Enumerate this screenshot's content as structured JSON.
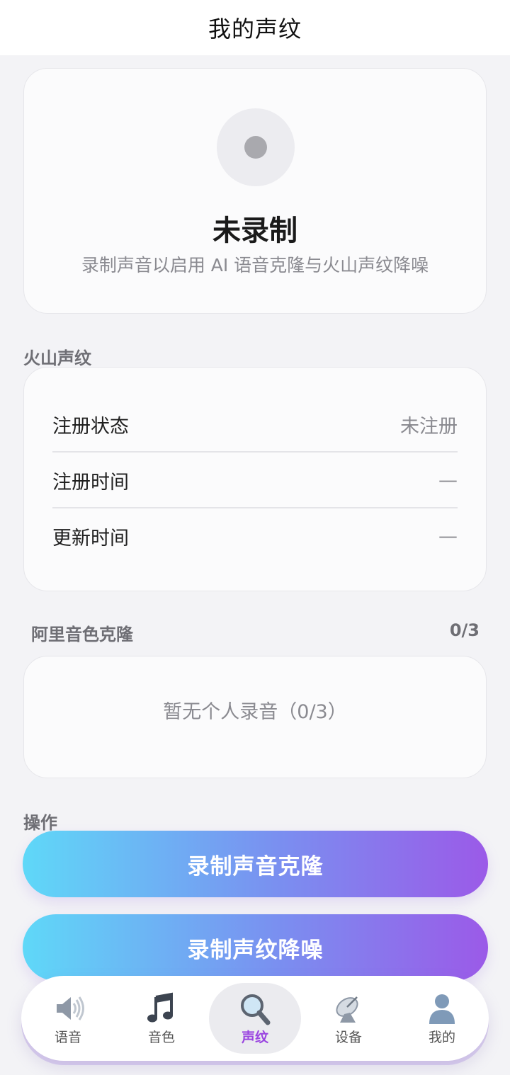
{
  "header": {
    "title": "我的声纹"
  },
  "status_card": {
    "title": "未录制",
    "subtitle": "录制声音以启用 AI 语音克隆与火山声纹降噪"
  },
  "volc_section": {
    "label": "火山声纹",
    "rows": [
      {
        "label": "注册状态",
        "value": "未注册"
      },
      {
        "label": "注册时间",
        "value": "—"
      },
      {
        "label": "更新时间",
        "value": "—"
      }
    ]
  },
  "ali_section": {
    "label": "阿里音色克隆",
    "count": "0/3",
    "empty_text": "暂无个人录音（0/3）"
  },
  "actions": {
    "label": "操作",
    "record_clone": "录制声音克隆",
    "record_denoise": "录制声纹降噪"
  },
  "tabbar": {
    "tabs": [
      {
        "label": "语音",
        "icon": "speaker-icon"
      },
      {
        "label": "音色",
        "icon": "music-note-icon"
      },
      {
        "label": "声纹",
        "icon": "magnifier-icon",
        "active": true
      },
      {
        "label": "设备",
        "icon": "satellite-dish-icon"
      },
      {
        "label": "我的",
        "icon": "user-icon"
      }
    ]
  },
  "colors": {
    "accent": "#9a45e0",
    "gradient_start": "#5fd8f8",
    "gradient_end": "#9b5ae8",
    "background": "#f3f3f6"
  }
}
